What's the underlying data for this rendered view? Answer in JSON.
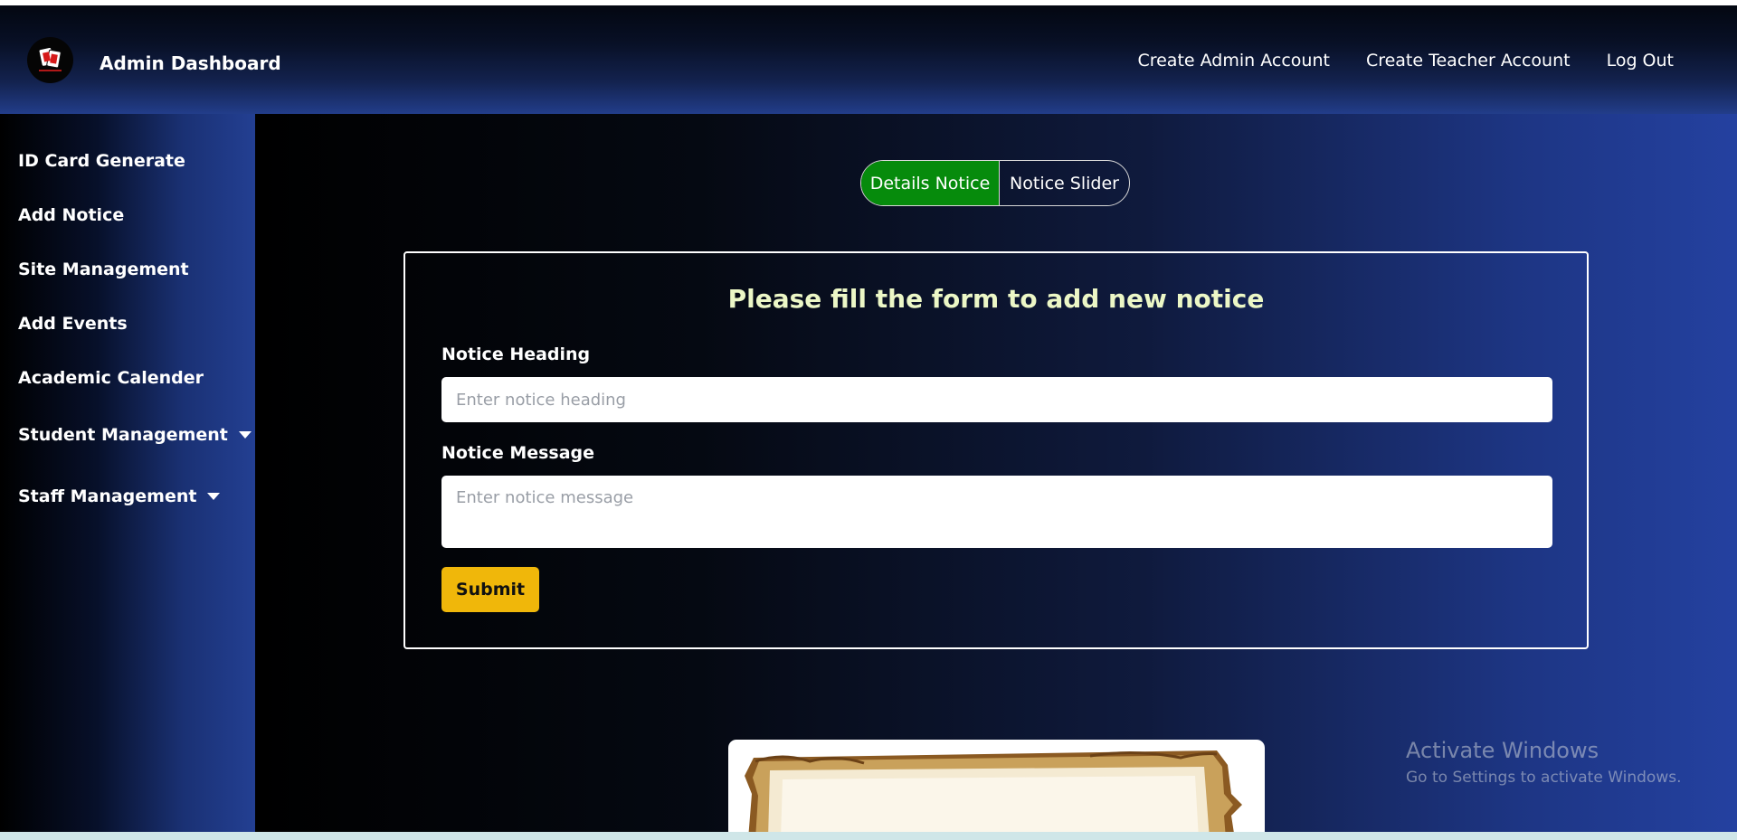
{
  "header": {
    "logo_icon": "logo-cards-icon",
    "title": "Admin Dashboard",
    "nav": [
      "Create Admin Account",
      "Create Teacher Account",
      "Log Out"
    ]
  },
  "sidebar": {
    "items": [
      {
        "label": "ID Card Generate"
      },
      {
        "label": "Add Notice"
      },
      {
        "label": "Site Management"
      },
      {
        "label": "Add Events"
      },
      {
        "label": "Academic Calender"
      },
      {
        "label": "Student Management",
        "icon": "caret-down-icon"
      },
      {
        "label": "Staff Management",
        "icon": "caret-down-icon"
      }
    ]
  },
  "toggle": {
    "active": "Details Notice",
    "other": "Notice Slider"
  },
  "form": {
    "title": "Please fill the form to add new notice",
    "heading_label": "Notice Heading",
    "heading_placeholder": "Enter notice heading",
    "heading_value": "",
    "message_label": "Notice Message",
    "message_placeholder": "Enter notice message",
    "message_value": "",
    "submit_label": "Submit"
  },
  "watermark": {
    "title": "Activate Windows",
    "subtitle": "Go to Settings to activate Windows."
  },
  "colors": {
    "accent_green": "#068b0c",
    "submit_yellow": "#f0b70a",
    "title_text": "#ecf7c6",
    "nav_blue": "#223d8a"
  }
}
